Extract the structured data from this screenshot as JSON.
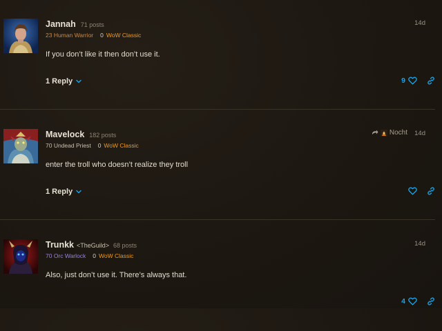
{
  "posts": [
    {
      "username": "Jannah",
      "guild": "",
      "post_count": "71 posts",
      "character": "23 Human Warrior",
      "level_number": "0",
      "game": "WoW Classic",
      "date": "14d",
      "reply_to_user": "",
      "body": "If you don’t like it then don’t use it.",
      "replies_label": "1 Reply",
      "likes": "9",
      "avatar_icon": "human-warrior-portrait",
      "like_icon": "heart-outline-icon",
      "share_icon": "link-icon"
    },
    {
      "username": "Mavelock",
      "guild": "",
      "post_count": "182 posts",
      "character": "70 Undead Priest",
      "level_number": "0",
      "game": "WoW Classic",
      "date": "14d",
      "reply_to_user": "Nocht",
      "body": "enter the troll who doesn’t realize they troll",
      "replies_label": "1 Reply",
      "likes": "",
      "avatar_icon": "undead-priest-portrait",
      "like_icon": "heart-outline-icon",
      "share_icon": "link-icon"
    },
    {
      "username": "Trunkk",
      "guild": "<TheGuild>",
      "post_count": "68 posts",
      "character": "70 Orc Warlock",
      "level_number": "0",
      "game": "WoW Classic",
      "date": "14d",
      "reply_to_user": "",
      "body": "Also, just don’t use it. There’s always that.",
      "replies_label": "",
      "likes": "4",
      "avatar_icon": "orc-warlock-portrait",
      "like_icon": "heart-outline-icon",
      "share_icon": "link-icon"
    }
  ],
  "colors": {
    "accent": "#18a4ea",
    "game": "#f29a1f",
    "warrior": "#c78a4a",
    "warlock": "#9a82d6",
    "background": "#1d1812"
  }
}
